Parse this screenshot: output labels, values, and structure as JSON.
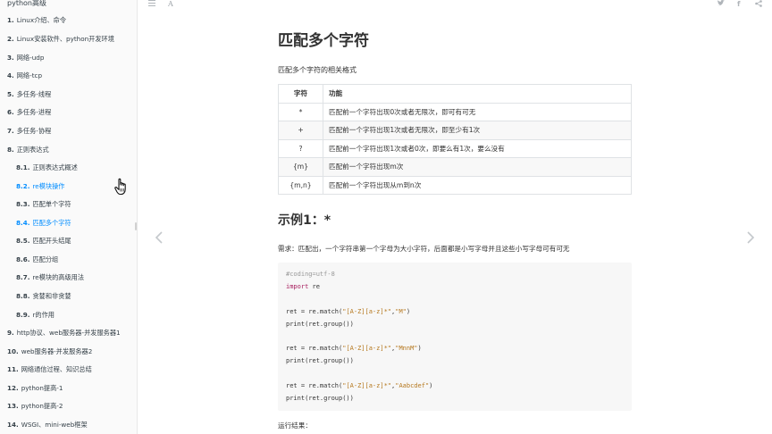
{
  "sidebar": {
    "title": "python高级",
    "items": [
      {
        "num": "1.",
        "label": "Linux介绍、命令"
      },
      {
        "num": "2.",
        "label": "Linux安装软件、python开发环境"
      },
      {
        "num": "3.",
        "label": "网络-udp"
      },
      {
        "num": "4.",
        "label": "网络-tcp"
      },
      {
        "num": "5.",
        "label": "多任务-线程"
      },
      {
        "num": "6.",
        "label": "多任务-进程"
      },
      {
        "num": "7.",
        "label": "多任务-协程"
      },
      {
        "num": "8.",
        "label": "正则表达式"
      },
      {
        "num": "8.1.",
        "label": "正则表达式概述"
      },
      {
        "num": "8.2.",
        "label": "re模块操作"
      },
      {
        "num": "8.3.",
        "label": "匹配单个字符"
      },
      {
        "num": "8.4.",
        "label": "匹配多个字符"
      },
      {
        "num": "8.5.",
        "label": "匹配开头结尾"
      },
      {
        "num": "8.6.",
        "label": "匹配分组"
      },
      {
        "num": "8.7.",
        "label": "re模块的高级用法"
      },
      {
        "num": "8.8.",
        "label": "贪婪和非贪婪"
      },
      {
        "num": "8.9.",
        "label": "r的作用"
      },
      {
        "num": "9.",
        "label": "http协议、web服务器-并发服务器1"
      },
      {
        "num": "10.",
        "label": "web服务器-并发服务器2"
      },
      {
        "num": "11.",
        "label": "网络通信过程、知识总结"
      },
      {
        "num": "12.",
        "label": "python提高-1"
      },
      {
        "num": "13.",
        "label": "python提高-2"
      },
      {
        "num": "14.",
        "label": "WSGI、mini-web框架"
      }
    ]
  },
  "toolbar": {
    "menu_icon": "hamburger-icon",
    "font_icon": "A"
  },
  "share": {
    "twitter": "twitter-icon",
    "facebook": "f",
    "share": "share-icon"
  },
  "page": {
    "title": "匹配多个字符",
    "intro": "匹配多个字符的相关格式",
    "table": {
      "headers": [
        "字符",
        "功能"
      ],
      "rows": [
        [
          "*",
          "匹配前一个字符出现0次或者无限次，即可有可无"
        ],
        [
          "+",
          "匹配前一个字符出现1次或者无限次，即至少有1次"
        ],
        [
          "?",
          "匹配前一个字符出现1次或者0次，即要么有1次，要么没有"
        ],
        [
          "{m}",
          "匹配前一个字符出现m次"
        ],
        [
          "{m,n}",
          "匹配前一个字符出现从m到n次"
        ]
      ]
    },
    "example_heading": "示例1：*",
    "requirement": "需求：匹配出，一个字符串第一个字母为大小字符，后面都是小写字母并且这些小写字母可有可无",
    "code": {
      "comment": "#coding=utf-8",
      "import_kw": "import",
      "import_mod": " re",
      "blocks": [
        {
          "pre": "ret = re.match(",
          "arg1": "\"[A-Z][a-z]*\"",
          "comma": ",",
          "arg2": "\"M\"",
          "post": ")",
          "print": "print(ret.group())"
        },
        {
          "pre": "ret = re.match(",
          "arg1": "\"[A-Z][a-z]*\"",
          "comma": ",",
          "arg2": "\"MnnM\"",
          "post": ")",
          "print": "print(ret.group())"
        },
        {
          "pre": "ret = re.match(",
          "arg1": "\"[A-Z][a-z]*\"",
          "comma": ",",
          "arg2": "\"Aabcdef\"",
          "post": ")",
          "print": "print(ret.group())"
        }
      ]
    },
    "result_label": "运行结果："
  },
  "colors": {
    "active": "#008cff",
    "keyword": "#a71d5d",
    "string": "#b5771d"
  }
}
